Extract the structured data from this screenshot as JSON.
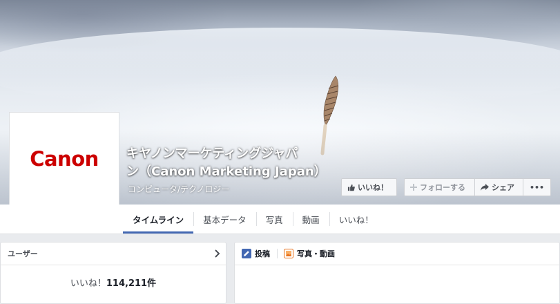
{
  "page": {
    "name_line1": "キヤノンマーケティングジャパ",
    "name_line2": "ン（Canon Marketing Japan）",
    "category": "コンピュータ/テクノロジー",
    "logo_text": "Canon"
  },
  "actions": {
    "like": "いいね！",
    "follow": "フォローする",
    "share": "シェア",
    "more": "•••"
  },
  "tabs": [
    "タイムライン",
    "基本データ",
    "写真",
    "動画",
    "いいね！"
  ],
  "active_tab": "タイムライン",
  "users": {
    "title": "ユーザー",
    "likes_prefix": "いいね！",
    "likes_count": "114,211件"
  },
  "composer": {
    "post_tab": "投稿",
    "photo_tab": "写真・動画"
  },
  "colors": {
    "logo_red": "#cc0000",
    "accent_blue": "#4267b2",
    "page_bg": "#e9ebee"
  }
}
